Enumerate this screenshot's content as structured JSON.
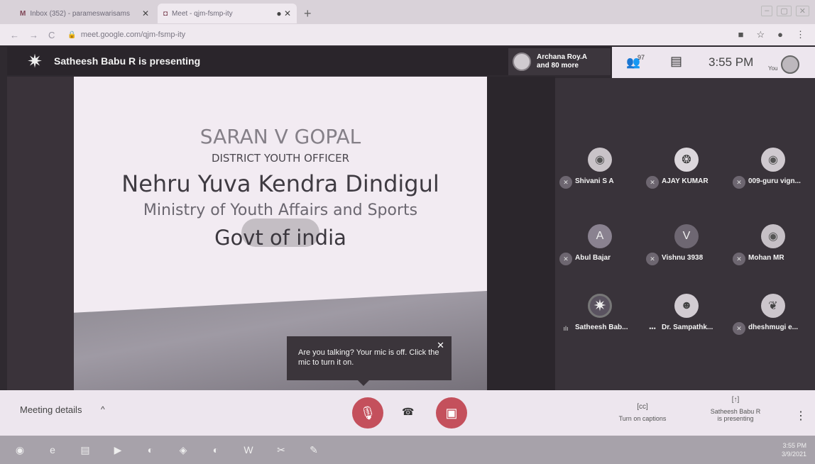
{
  "browser": {
    "tabs": [
      {
        "label": "Inbox (352) - parameswarisams",
        "fav": "M"
      },
      {
        "label": "Meet - qjm-fsmp-ity",
        "fav": "◘"
      }
    ],
    "new_tab": "+",
    "url": "meet.google.com/qjm-fsmp-ity"
  },
  "meet": {
    "presenting_title": "Satheesh Babu R is presenting",
    "archana": {
      "line1": "Archana Roy.A",
      "line2": "and 80 more"
    },
    "people_count": "97",
    "time": "3:55 PM",
    "you_label": "You",
    "slide": {
      "line1": "SARAN V GOPAL",
      "line2": "DISTRICT YOUTH OFFICER",
      "line3": "Nehru Yuva Kendra Dindigul",
      "line4": "Ministry of Youth Affairs and Sports",
      "line5": "Govt of india"
    },
    "tooltip": "Are you talking? Your mic is off. Click the mic to turn it on.",
    "participants": [
      {
        "name": "Shivani S A",
        "initial": ""
      },
      {
        "name": "AJAY KUMAR",
        "initial": ""
      },
      {
        "name": "009-guru vign...",
        "initial": ""
      },
      {
        "name": "Abul Bajar",
        "initial": "A"
      },
      {
        "name": "Vishnu 3938",
        "initial": "V"
      },
      {
        "name": "Mohan MR",
        "initial": ""
      },
      {
        "name": "Satheesh Bab...",
        "initial": ""
      },
      {
        "name": "Dr. Sampathk...",
        "initial": ""
      },
      {
        "name": "dheshmugi e...",
        "initial": ""
      }
    ]
  },
  "bottom": {
    "meeting_details": "Meeting details",
    "captions": "Turn on captions",
    "presenting_line1": "Satheesh Babu R",
    "presenting_line2": "is presenting"
  },
  "taskbar": {
    "time": "3:55 PM",
    "date": "3/9/2021"
  },
  "colors": {
    "red": "#c4505c",
    "dark_panel": "#39333a"
  }
}
